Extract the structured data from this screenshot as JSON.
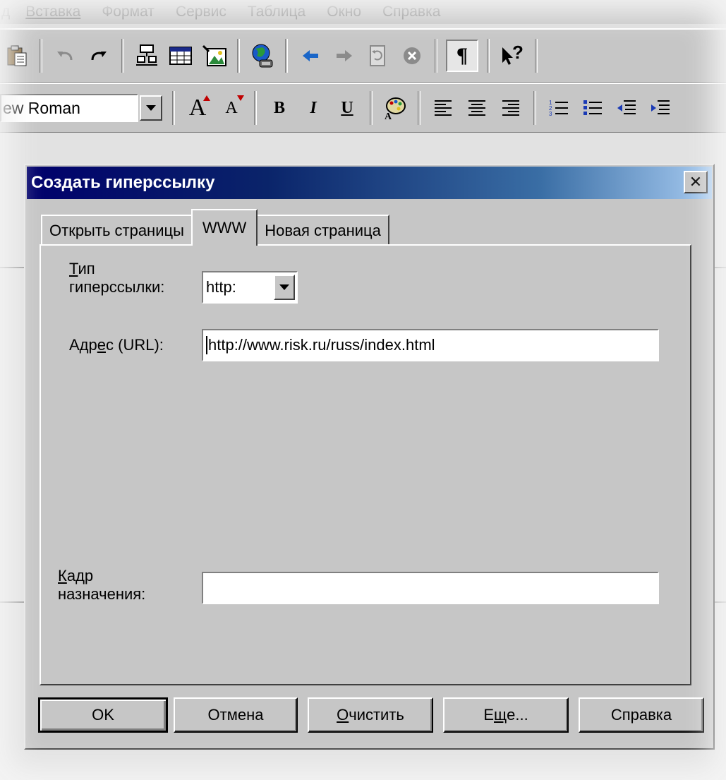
{
  "menu": {
    "items": [
      "д",
      "Вставка",
      "Формат",
      "Сервис",
      "Таблица",
      "Окно",
      "Справка"
    ]
  },
  "toolbar1": {
    "icons": [
      "paste-icon",
      "undo-icon",
      "redo-icon",
      "form-icon",
      "table-icon",
      "image-icon",
      "web-globe-icon",
      "back-arrow-icon",
      "forward-arrow-icon",
      "refresh-icon",
      "stop-icon",
      "paragraph-icon",
      "help-pointer-icon"
    ],
    "paragraph_glyph": "¶",
    "help_glyph": "?"
  },
  "toolbar2": {
    "font_name": "ew Roman",
    "grow_font": "A",
    "shrink_font": "A",
    "bold": "B",
    "italic": "I",
    "underline": "U"
  },
  "dialog": {
    "title": "Создать гиперссылку",
    "close_glyph": "✕",
    "tabs": [
      {
        "label": "Открыть страницы",
        "active": false
      },
      {
        "label": "WWW",
        "active": true
      },
      {
        "label": "Новая страница",
        "active": false
      }
    ],
    "link_type": {
      "label_line1_accel": "Т",
      "label_line1_rest": "ип",
      "label_line2": "гиперссылки:",
      "value": "http:"
    },
    "url": {
      "label_prefix": "Адр",
      "label_accel": "е",
      "label_suffix": "с (URL):",
      "value": "http://www.risk.ru/russ/index.html"
    },
    "target_frame": {
      "label_line1_accel": "К",
      "label_line1_rest": "адр",
      "label_line2": "назначения:",
      "value": ""
    },
    "buttons": {
      "ok": "OK",
      "cancel": "Отмена",
      "clear_accel": "О",
      "clear_rest": "чистить",
      "more_prefix": "Е",
      "more_accel": "щ",
      "more_suffix": "е...",
      "help": "Справка"
    }
  },
  "colors": {
    "face": "#c6c6c6",
    "title_start": "#00006b",
    "title_end": "#a6caf0",
    "link_blue": "#1d3bb5"
  }
}
